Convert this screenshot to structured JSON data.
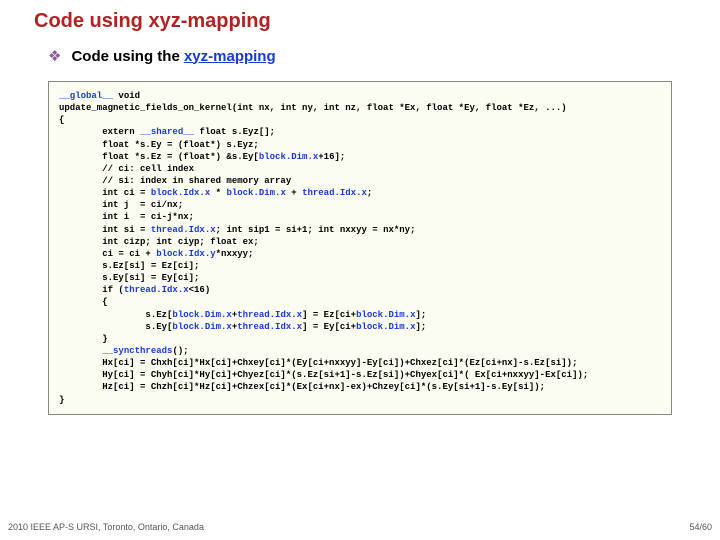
{
  "title": "Code using xyz-mapping",
  "bullet": {
    "prefix": "Code using the ",
    "link": "xyz-mapping"
  },
  "code": {
    "l01a": "__global__",
    "l01b": " void",
    "l02": "update_magnetic_fields_on_kernel(int nx, int ny, int nz, float *Ex, float *Ey, float *Ez, ...)",
    "l03": "{",
    "l04a": "        extern ",
    "l04b": "__shared__",
    "l04c": " float s.Eyz[];",
    "l05": "        float *s.Ey = (float*) s.Eyz;",
    "l06a": "        float *s.Ez = (float*) &s.Ey[",
    "l06b": "block.Dim.x",
    "l06c": "+16];",
    "l07": "        // ci: cell index",
    "l08": "        // si: index in shared memory array",
    "l09a": "        int ci = ",
    "l09b": "block.Idx.x",
    "l09c": " * ",
    "l09d": "block.Dim.x",
    "l09e": " + ",
    "l09f": "thread.Idx.x",
    "l09g": ";",
    "l10": "        int j  = ci/nx;",
    "l11": "        int i  = ci-j*nx;",
    "l12a": "        int si = ",
    "l12b": "thread.Idx.x",
    "l12c": "; int sip1 = si+1; int nxxyy = nx*ny;",
    "l13": "        int cizp; int ciyp; float ex;",
    "l14a": "        ci = ci + ",
    "l14b": "block.Idx.y",
    "l14c": "*nxxyy;",
    "l15": "        s.Ez[si] = Ez[ci];",
    "l16": "        s.Ey[si] = Ey[ci];",
    "l17a": "        if (",
    "l17b": "thread.Idx.x",
    "l17c": "<16)",
    "l18": "        {",
    "l19a": "                s.Ez[",
    "l19b": "block.Dim.x",
    "l19c": "+",
    "l19d": "thread.Idx.x",
    "l19e": "] = Ez[ci+",
    "l19f": "block.Dim.x",
    "l19g": "];",
    "l20a": "                s.Ey[",
    "l20b": "block.Dim.x",
    "l20c": "+",
    "l20d": "thread.Idx.x",
    "l20e": "] = Ey[ci+",
    "l20f": "block.Dim.x",
    "l20g": "];",
    "l21": "        }",
    "l22a": "        ",
    "l22b": "__syncthreads",
    "l22c": "();",
    "l23": "        Hx[ci] = Chxh[ci]*Hx[ci]+Chxey[ci]*(Ey[ci+nxxyy]-Ey[ci])+Chxez[ci]*(Ez[ci+nx]-s.Ez[si]);",
    "l24": "        Hy[ci] = Chyh[ci]*Hy[ci]+Chyez[ci]*(s.Ez[si+1]-s.Ez[si])+Chyex[ci]*( Ex[ci+nxxyy]-Ex[ci]);",
    "l25": "        Hz[ci] = Chzh[ci]*Hz[ci]+Chzex[ci]*(Ex[ci+nx]-ex)+Chzey[ci]*(s.Ey[si+1]-s.Ey[si]);",
    "l26": "}"
  },
  "footer": {
    "left": "2010 IEEE AP-S URSI, Toronto, Ontario, Canada",
    "right": "54/60"
  }
}
